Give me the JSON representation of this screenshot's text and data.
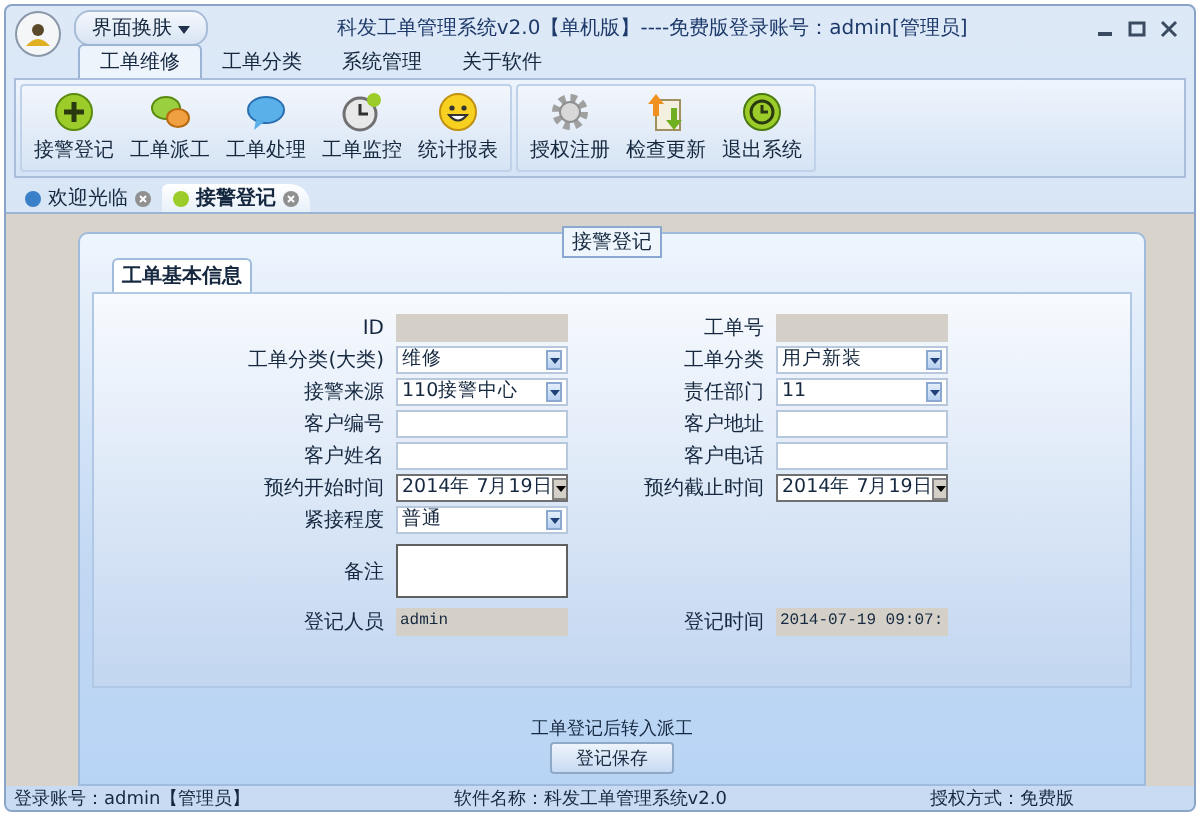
{
  "title_bar": {
    "skin_button": "界面换肤",
    "title": "科发工单管理系统v2.0【单机版】----免费版登录账号：admin[管理员]"
  },
  "ribbon_tabs": [
    {
      "label": "工单维修",
      "selected": true
    },
    {
      "label": "工单分类",
      "selected": false
    },
    {
      "label": "系统管理",
      "selected": false
    },
    {
      "label": "关于软件",
      "selected": false
    }
  ],
  "ribbon_groups": [
    {
      "buttons": [
        {
          "label": "接警登记",
          "kind": "add"
        },
        {
          "label": "工单派工",
          "kind": "chat"
        },
        {
          "label": "工单处理",
          "kind": "bubble"
        },
        {
          "label": "工单监控",
          "kind": "clock"
        },
        {
          "label": "统计报表",
          "kind": "smile"
        }
      ]
    },
    {
      "buttons": [
        {
          "label": "授权注册",
          "kind": "gear"
        },
        {
          "label": "检查更新",
          "kind": "update"
        },
        {
          "label": "退出系统",
          "kind": "exit"
        }
      ]
    }
  ],
  "doc_tabs": [
    {
      "label": "欢迎光临",
      "selected": false
    },
    {
      "label": "接警登记",
      "selected": true
    }
  ],
  "group_title": "接警登记",
  "form_tab": "工单基本信息",
  "form_rows": [
    {
      "cells": [
        {
          "label": "ID",
          "kind": "readonly"
        },
        {
          "label": "工单号",
          "kind": "readonly"
        }
      ]
    },
    {
      "cells": [
        {
          "label": "工单分类(大类)",
          "kind": "combo",
          "value": "维修"
        },
        {
          "label": "工单分类",
          "kind": "combo",
          "value": "用户新装"
        }
      ]
    },
    {
      "cells": [
        {
          "label": "接警来源",
          "kind": "combo",
          "value": "110接警中心"
        },
        {
          "label": "责任部门",
          "kind": "combo",
          "value": "11"
        }
      ]
    },
    {
      "cells": [
        {
          "label": "客户编号",
          "kind": "text"
        },
        {
          "label": "客户地址",
          "kind": "text"
        }
      ]
    },
    {
      "cells": [
        {
          "label": "客户姓名",
          "kind": "text"
        },
        {
          "label": "客户电话",
          "kind": "text"
        }
      ]
    },
    {
      "cells": [
        {
          "label": "预约开始时间",
          "kind": "date",
          "value": "2014年 7月19日"
        },
        {
          "label": "预约截止时间",
          "kind": "date",
          "value": "2014年 7月19日"
        }
      ]
    },
    {
      "cells": [
        {
          "label": "紧接程度",
          "kind": "combo",
          "value": "普通"
        }
      ]
    },
    {
      "cells": [
        {
          "label": "备注",
          "kind": "textarea"
        }
      ]
    },
    {
      "cells": [
        {
          "label": "登记人员",
          "kind": "readonly",
          "value": "admin"
        },
        {
          "label": "登记时间",
          "kind": "readonly",
          "value": "2014-07-19 09:07:"
        }
      ]
    }
  ],
  "transfer_note": "工单登记后转入派工",
  "save_button": "登记保存",
  "status_bar": {
    "account": "登录账号：admin【管理员】",
    "software": "软件名称：科发工单管理系统v2.0",
    "license": "授权方式：免费版"
  }
}
